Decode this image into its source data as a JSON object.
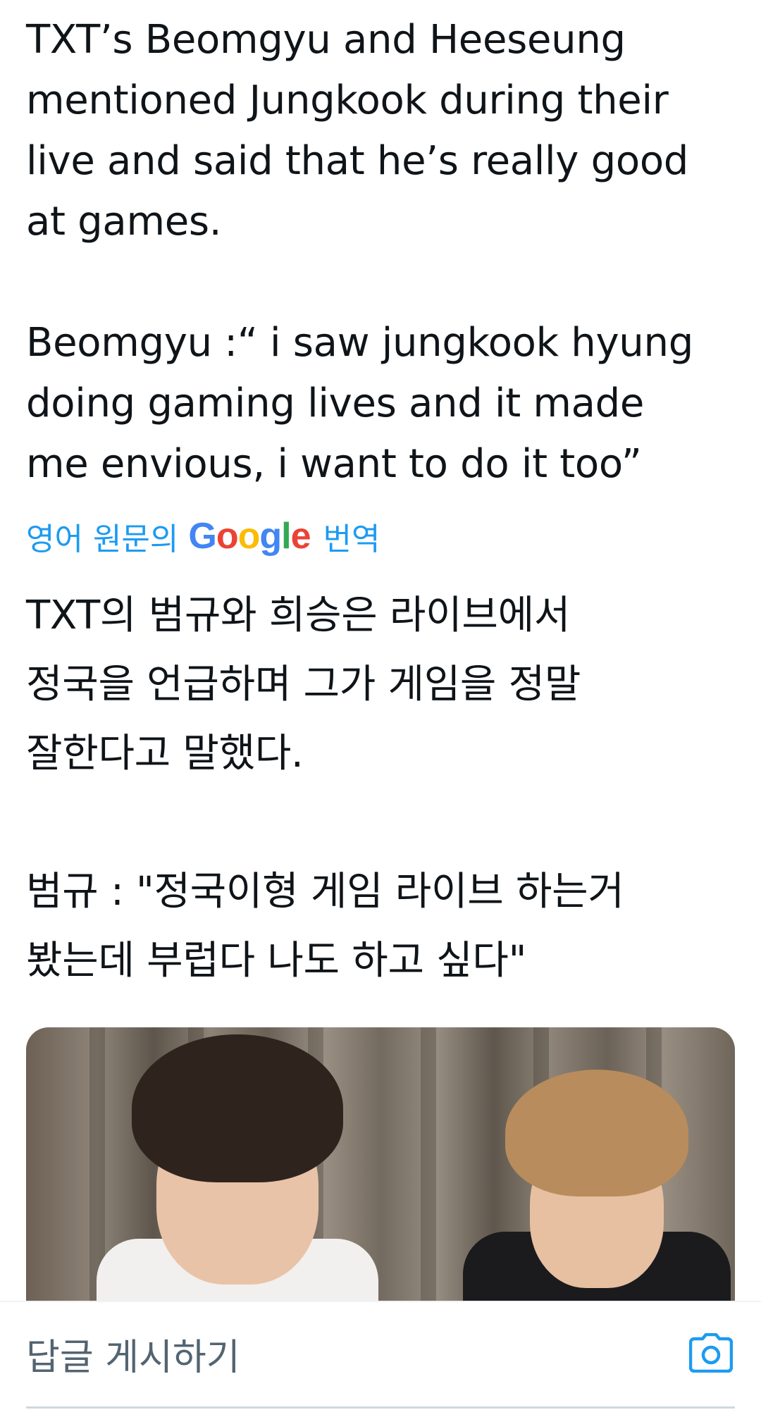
{
  "tweet": {
    "text_original": "TXT’s Beomgyu and Heeseung\nmentioned Jungkook during their\nlive and said that he’s really good\nat games.\n\nBeomgyu :“ i saw jungkook hyung\ndoing gaming lives and it made\nme envious, i want to do it too”",
    "translation_link": {
      "prefix": "영어 원문의",
      "provider_letters": [
        "G",
        "o",
        "o",
        "g",
        "l",
        "e"
      ],
      "provider_colors": [
        "#4285F4",
        "#EA4335",
        "#FBBC05",
        "#4285F4",
        "#34A853",
        "#EA4335"
      ],
      "suffix": "번역"
    },
    "text_translated": "TXT의 범규와 희승은 라이브에서\n정국을 언급하며 그가 게임을 정말\n잘한다고 말했다.\n\n범규 : \"정국이형 게임 라이브 하는거\n봤는데 부럽다 나도 하고 싶다\""
  },
  "reply_bar": {
    "placeholder": "답글 게시하기",
    "camera_icon": "camera-icon"
  },
  "colors": {
    "link": "#1d9bf0",
    "text": "#0f1419",
    "secondary": "#536471"
  }
}
